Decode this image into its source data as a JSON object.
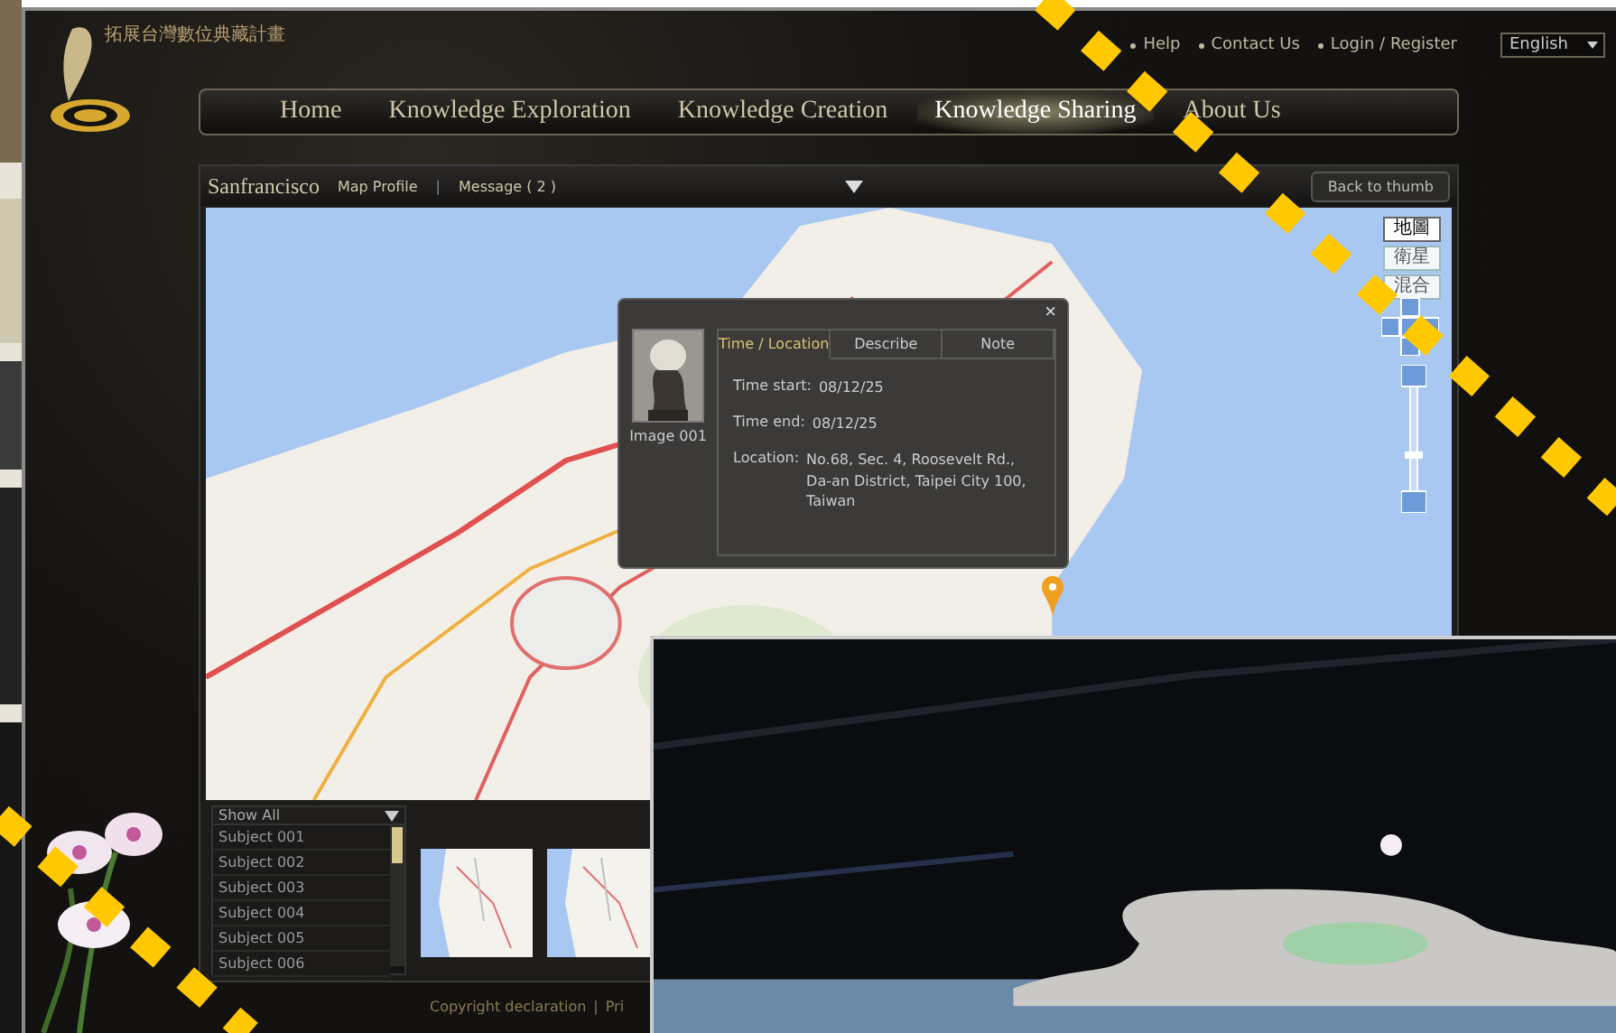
{
  "logo": {
    "title": "拓展台灣數位典藏計畫"
  },
  "top_links": [
    {
      "label": "Help"
    },
    {
      "label": "Contact Us"
    },
    {
      "label": "Login / Register"
    }
  ],
  "language": {
    "value": "English"
  },
  "nav": [
    {
      "label": "Home",
      "selected": false
    },
    {
      "label": "Knowledge Exploration",
      "selected": false
    },
    {
      "label": "Knowledge Creation",
      "selected": false
    },
    {
      "label": "Knowledge Sharing",
      "selected": true
    },
    {
      "label": "About Us",
      "selected": false
    }
  ],
  "subbar": {
    "title": "Sanfrancisco",
    "links": [
      "Map Profile",
      "Message ( 2 )"
    ],
    "separator": "|",
    "back_button": "Back to thumb"
  },
  "map": {
    "type_buttons": [
      {
        "label": "地圖",
        "selected": true
      },
      {
        "label": "衛星",
        "selected": false
      },
      {
        "label": "混合",
        "selected": false
      }
    ],
    "popup": {
      "image_caption": "Image 001",
      "close": "×",
      "tabs": [
        {
          "label": "Time / Location",
          "selected": true
        },
        {
          "label": "Describe",
          "selected": false
        },
        {
          "label": "Note",
          "selected": false
        }
      ],
      "fields": [
        {
          "label": "Time start:",
          "value": "08/12/25"
        },
        {
          "label": "Time end:",
          "value": "08/12/25"
        },
        {
          "label": "Location:",
          "value": "No.68, Sec. 4, Roosevelt Rd., Da-an District, Taipei City 100, Taiwan"
        }
      ]
    }
  },
  "subject_list": {
    "value": "Show All",
    "items": [
      "Subject 001",
      "Subject 002",
      "Subject 003",
      "Subject 004",
      "Subject 005",
      "Subject 006"
    ]
  },
  "footer": {
    "links": [
      "Copyright declaration",
      "Pri"
    ],
    "separator": "|"
  }
}
